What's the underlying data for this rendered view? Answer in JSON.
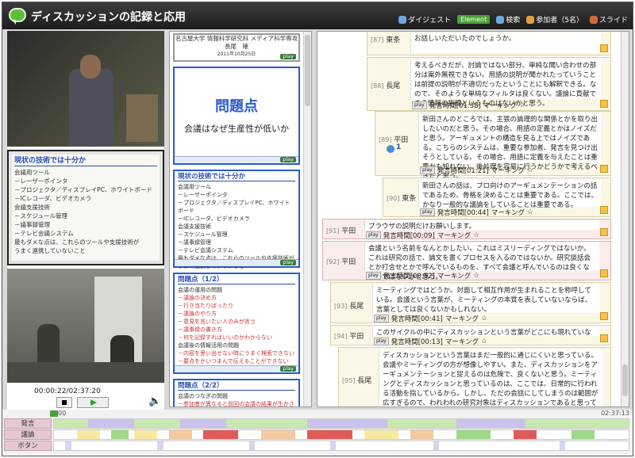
{
  "app": {
    "title": "ディスカッションの記録と応用"
  },
  "menu": [
    {
      "label": "ダイジェスト",
      "icon": "digest-icon"
    },
    {
      "label": "Element",
      "icon": "element-icon"
    },
    {
      "label": "検索",
      "icon": "search-icon"
    },
    {
      "label": "参加者（5名）",
      "icon": "participants-icon"
    },
    {
      "label": "スライド",
      "icon": "slide-icon"
    }
  ],
  "player": {
    "time": "00:00:22/02:37:20"
  },
  "slides": {
    "s1_line1": "名古屋大学 情報科学研究科 メディア科学専攻",
    "s1_line2": "長尾　確",
    "s1_line3": "2011年10月25日",
    "s2_title": "問題点",
    "s2_sub": "会議はなぜ生産性が低いか",
    "s3_head": "現状の技術では十分か",
    "s3_items": [
      "会議用ツール",
      "－レーザーポインタ",
      "－プロジェクタ／ディスプレイPC、ホワイトボード",
      "－ICレコーダ、ビデオカメラ",
      "会議支援技術",
      "－スケジュール管理",
      "－議事録管理",
      "－テレビ会議システム",
      "最もダメな点は、これらのツールや支援技術が",
      "うまく連携していないこと"
    ],
    "s4_head": "問題点（1/2）",
    "s4_items": [
      "会議の運用の問題",
      "－議論の決め方",
      "－行き当たりばったり",
      "－議論のやり方",
      "－意見を言いたい人のみが言う",
      "－議事録の書き方",
      "－何を記録すればいいのかわからない",
      "会議後の情報活用の問題",
      "－内容を思い出せない時にうまく検索できない",
      "－要点をかいつまんで伝えることができない"
    ],
    "s5_head": "問題点（2/2）",
    "s5_items": [
      "会議のつなぎの問題",
      "－参加者が異なると前回の会議の結果が生かされない"
    ],
    "play": "play"
  },
  "messages": [
    {
      "num": "[87]",
      "name": "東条",
      "text": "お話しいただいたのでしょうか。"
    },
    {
      "num": "[88]",
      "name": "長尾",
      "text": "考えるべきだが、討論ではない部分、単純な聞い合わせの部分は案外無視できない。用語の説明が聞かれたっていうことは前提の説明が不適切だったということにも解釈できる。なので、そのような単純なフィルタは良くない。議論に貢献できる情報の指標というものはないかと思う。",
      "time": "発言時間[01:38]"
    },
    {
      "num": "[89]",
      "name": "平田",
      "badge": "1",
      "text": "新田さんのところでは、主張の論理的な関係とかを取り出したいのだと思う。その場合、用語の定義とかはノイズだと思う。アーギュメントの構造を見る上ではノイズである。こちらのシステムは、重要な参加者、発言を見つけ出そうとしている。その場合、用語に定義を与えたことは重要かも知れない。後処理を容易に行うかどうかで考えるべきだと思う。",
      "time": "発言時間[01:21]"
    },
    {
      "num": "[90]",
      "name": "東条",
      "text": "新田さんの話は、プロ向けのアーギュメンテーションの話であるため、骨格を決めることは重要である。ここでは、かなり一般的な議論をしていることは重要である。",
      "time": "発言時間[00:44]"
    },
    {
      "num": "[91]",
      "name": "平田",
      "text": "ブラウザの説明だけお願いします。",
      "time": "発言時間[00:09]"
    },
    {
      "num": "[92]",
      "name": "平田",
      "text": "会議という名前をなんとかしたい。これはミスリーディングではないか。これは研究の話で、論文を書くプロセスを入るのではないか。研究談話会とか打合せとかで呼んでいるものを、すべて会議と呼んでいるのは良くないのではないかと思う。",
      "time": "発言時間[00:52]"
    },
    {
      "num": "[93]",
      "name": "長尾",
      "text": "ミーティングではどうか。対面して相互作用が生まれることを称呼している。会議という言葉が、ミーティングの本質を表していないならば、言葉としては良くないかもしれない。",
      "time": "発言時間[00:41]"
    },
    {
      "num": "[94]",
      "name": "平田",
      "text": "このサイクルの中にディスカッションという言葉がどこにも現れていない。",
      "time": "発言時間[00:13]"
    },
    {
      "num": "[95]",
      "name": "長尾",
      "text": "ディスカッションという言葉はまだ一般的に通じにくいと思っている。会議やミーティングの方が想像しやすい。また、ディスカッションをアーギュメンテーションと捉えるのは危険で、良くないと思う。ミーティングとディスカッションと思っているのは、ここでは、日常的に行われる活動を指しているから。しかし、ただの会話にしてしまうのは範囲が広すぎるので、われわれの研究対象はディスカッションであると思っている。"
    }
  ],
  "meta": {
    "play": "play",
    "marking": "マーキング"
  },
  "timeline": {
    "start": "00",
    "end": "02:37:13",
    "rows": [
      {
        "label": "発言",
        "color": "#c9c3ee"
      },
      {
        "label": "議論",
        "color": "#f8e9a0"
      },
      {
        "label": "ボタン",
        "color": "#d6d6f2"
      }
    ]
  }
}
